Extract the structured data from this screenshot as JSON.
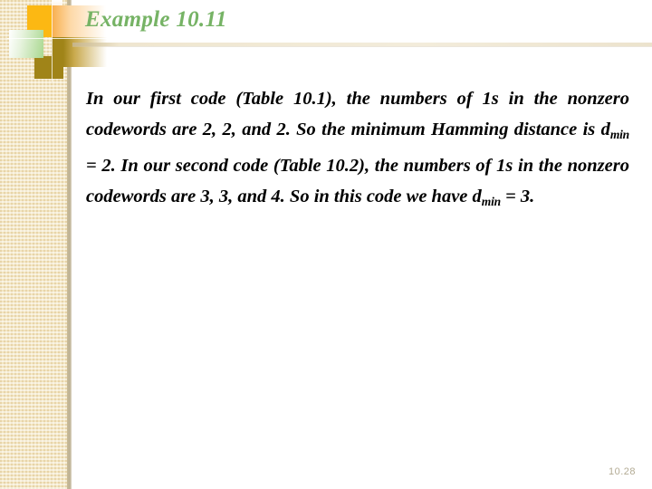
{
  "slide": {
    "title": "Example 10.11",
    "page_number": "10.28",
    "colors": {
      "title_green": "#76b365",
      "band_beige": "#f3e6c3",
      "accent_orange": "#fcb813",
      "accent_olive": "#a08418",
      "accent_green": "#a9d890",
      "page_number_gray": "#b3ab94",
      "body_black": "#000000"
    },
    "body": {
      "paragraph_segments": [
        {
          "type": "text",
          "value": "In our first code (Table 10.1), the numbers of 1s in the nonzero codewords are 2, 2, and 2. So the minimum Hamming distance is d"
        },
        {
          "type": "subscript",
          "value": "min"
        },
        {
          "type": "text",
          "value": " = 2. In our second code (Table 10.2), the numbers of 1s in the nonzero codewords are 3, 3, and 4. So in this code we have d"
        },
        {
          "type": "subscript",
          "value": "min"
        },
        {
          "type": "text",
          "value": " = 3."
        }
      ],
      "line1": "In our first code (Table 10.1), the numbers of 1s in",
      "line2": "the nonzero codewords are 2, 2, and 2. So the",
      "line3_a": "minimum Hamming distance is d",
      "line3_sub": "min",
      "line3_b": " = 2. In our",
      "line4": "second code (Table 10.2), the numbers of 1s in the",
      "line5": "nonzero codewords are 3, 3, and 4. So in this code",
      "line6_a": "we have d",
      "line6_sub": "min",
      "line6_b": " = 3."
    }
  },
  "decor": {
    "orange_square": "orange-square",
    "green_square": "green-gradient-square",
    "olive_square": "olive-square",
    "horizontal_rule": "title-divider-rule"
  }
}
